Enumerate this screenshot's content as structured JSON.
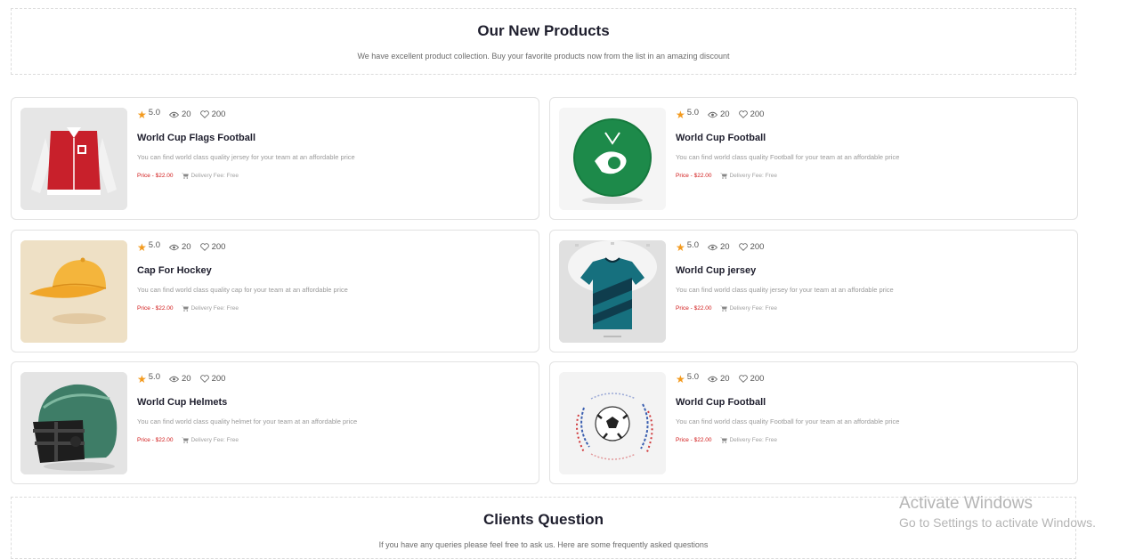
{
  "products_section": {
    "title": "Our New Products",
    "subtitle": "We have excellent product collection. Buy your favorite products now from the list in an amazing discount"
  },
  "products": [
    {
      "image_icon": "varsity-jacket",
      "rating": "5.0",
      "views": "20",
      "likes": "200",
      "title": "World Cup Flags Football",
      "description": "You can find world class quality jersey for your team at an affordable price",
      "price": "Price - $22.00",
      "delivery": "Delivery Fee: Free"
    },
    {
      "image_icon": "green-football",
      "rating": "5.0",
      "views": "20",
      "likes": "200",
      "title": "World Cup Football",
      "description": "You can find world class quality Football for your team at an affordable price",
      "price": "Price - $22.00",
      "delivery": "Delivery Fee: Free"
    },
    {
      "image_icon": "yellow-cap",
      "rating": "5.0",
      "views": "20",
      "likes": "200",
      "title": "Cap For Hockey",
      "description": "You can find world class quality cap for your team at an affordable price",
      "price": "Price - $22.00",
      "delivery": "Delivery Fee: Free"
    },
    {
      "image_icon": "football-jersey",
      "rating": "5.0",
      "views": "20",
      "likes": "200",
      "title": "World Cup jersey",
      "description": "You can find world class quality jersey for your team at an affordable price",
      "price": "Price - $22.00",
      "delivery": "Delivery Fee: Free"
    },
    {
      "image_icon": "football-helmet",
      "rating": "5.0",
      "views": "20",
      "likes": "200",
      "title": "World Cup Helmets",
      "description": "You can find world class quality helmet for your team at an affordable price",
      "price": "Price - $22.00",
      "delivery": "Delivery Fee: Free"
    },
    {
      "image_icon": "soccer-ball",
      "rating": "5.0",
      "views": "20",
      "likes": "200",
      "title": "World Cup Football",
      "description": "You can find world class quality Football for your team at an affordable price",
      "price": "Price - $22.00",
      "delivery": "Delivery Fee: Free"
    }
  ],
  "clients_section": {
    "title": "Clients Question",
    "subtitle": "If you have any queries please feel free to ask us. Here are some frequently asked questions"
  },
  "watermark": {
    "title": "Activate Windows",
    "subtitle": "Go to Settings to activate Windows."
  },
  "colors": {
    "accent_star": "#f39a1e",
    "price_red": "#d11a1a"
  }
}
